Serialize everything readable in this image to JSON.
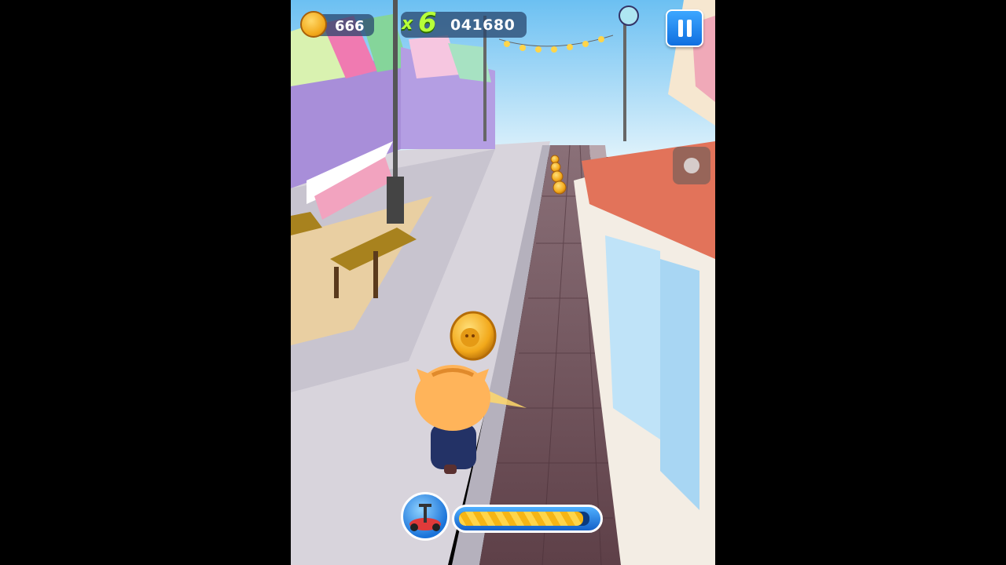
{
  "hud": {
    "coin_count": "666",
    "multiplier_prefix": "x",
    "multiplier_value": "6",
    "score": "041680",
    "coin_icon": "cat-coin-icon",
    "pause_icon": "pause-icon"
  },
  "powerup": {
    "icon": "scooter-icon",
    "level": 0.95
  },
  "colors": {
    "accent_blue": "#1a73d9",
    "multiplier_green": "#b7ff3a",
    "coin_gold": "#f2a81a"
  }
}
